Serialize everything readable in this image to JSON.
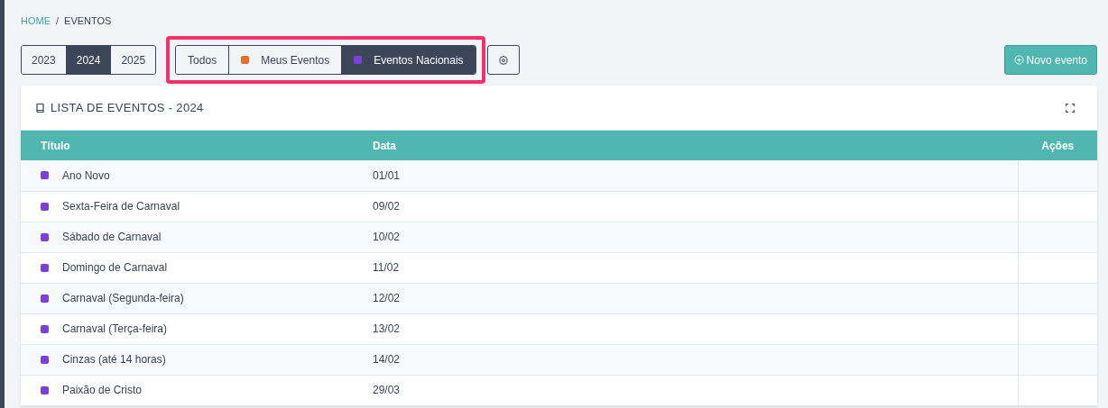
{
  "breadcrumb": [
    {
      "label": "HOME",
      "kind": "link"
    },
    {
      "label": "/",
      "kind": "separator"
    },
    {
      "label": "EVENTOS",
      "kind": "current"
    }
  ],
  "years": [
    {
      "label": "2023",
      "selected": false
    },
    {
      "label": "2024",
      "selected": true
    },
    {
      "label": "2025",
      "selected": false
    }
  ],
  "filters": [
    {
      "label": "Todos",
      "selected": false
    },
    {
      "label": "Meus Eventos",
      "selected": false,
      "color": "#e8702a"
    },
    {
      "label": "Eventos Nacionais",
      "selected": true,
      "color": "#7e3fd8"
    }
  ],
  "new_button": "Novo evento",
  "card": {
    "title": "LISTA DE EVENTOS - 2024"
  },
  "table": {
    "columns": [
      "Título",
      "Data",
      "Ações"
    ],
    "rows": [
      {
        "title": "Ano Novo",
        "date": "01/01",
        "color": "#7e3fd8"
      },
      {
        "title": "Sexta-Feira de Carnaval",
        "date": "09/02",
        "color": "#7e3fd8"
      },
      {
        "title": "Sábado de Carnaval",
        "date": "10/02",
        "color": "#7e3fd8"
      },
      {
        "title": "Domingo de Carnaval",
        "date": "11/02",
        "color": "#7e3fd8"
      },
      {
        "title": "Carnaval (Segunda-feira)",
        "date": "12/02",
        "color": "#7e3fd8"
      },
      {
        "title": "Carnaval (Terça-feira)",
        "date": "13/02",
        "color": "#7e3fd8"
      },
      {
        "title": "Cinzas (até 14 horas)",
        "date": "14/02",
        "color": "#7e3fd8"
      },
      {
        "title": "Paixão de Cristo",
        "date": "29/03",
        "color": "#7e3fd8"
      }
    ]
  }
}
